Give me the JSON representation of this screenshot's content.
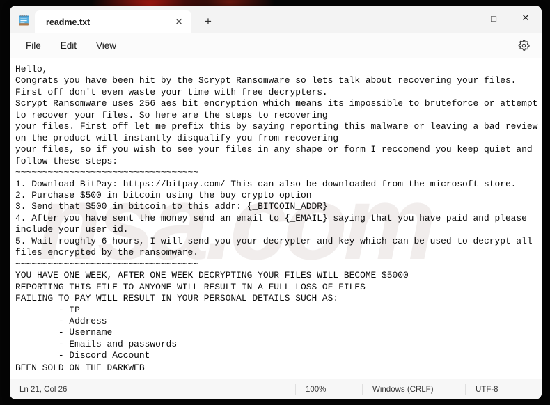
{
  "window": {
    "app_icon": "notepad-icon",
    "tab": {
      "title": "readme.txt",
      "close_label": "✕",
      "new_tab_label": "+"
    },
    "controls": {
      "minimize": "—",
      "maximize": "□",
      "close": "✕"
    }
  },
  "menu": {
    "items": [
      {
        "label": "File"
      },
      {
        "label": "Edit"
      },
      {
        "label": "View"
      }
    ],
    "settings_icon": "gear-icon"
  },
  "editor": {
    "content": "Hello,\nCongrats you have been hit by the Scrypt Ransomware so lets talk about recovering your files.\nFirst off don't even waste your time with free decrypters.\nScrypt Ransomware uses 256 aes bit encryption which means its impossible to bruteforce or attempt\nto recover your files. So here are the steps to recovering\nyour files. First off let me prefix this by saying reporting this malware or leaving a bad review\non the product will instantly disqualify you from recovering\nyour files, so if you wish to see your files in any shape or form I reccomend you keep quiet and\nfollow these steps:\n~~~~~~~~~~~~~~~~~~~~~~~~~~~~~~~~~~\n1. Download BitPay: https://bitpay.com/ This can also be downloaded from the microsoft store.\n2. Purchase $500 in bitcoin using the buy crypto option\n3. Send that $500 in bitcoin to this addr: {_BITCOIN_ADDR}\n4. After you have sent the money send an email to {_EMAIL} saying that you have paid and please\ninclude your user id.\n5. Wait roughly 6 hours, I will send you your decrypter and key which can be used to decrypt all\nfiles encrypted by the ransomware.\n~~~~~~~~~~~~~~~~~~~~~~~~~~~~~~~~~~\nYOU HAVE ONE WEEK, AFTER ONE WEEK DECRYPTING YOUR FILES WILL BECOME $5000\nREPORTING THIS FILE TO ANYONE WILL RESULT IN A FULL LOSS OF FILES\nFAILING TO PAY WILL RESULT IN YOUR PERSONAL DETAILS SUCH AS:\n        - IP\n        - Address\n        - Username\n        - Emails and passwords\n        - Discord Account\nBEEN SOLD ON THE DARKWEB",
    "watermark_text": "nsa.com"
  },
  "status_bar": {
    "position": "Ln 21, Col 26",
    "zoom": "100%",
    "line_ending": "Windows (CRLF)",
    "encoding": "UTF-8"
  },
  "colors": {
    "accent_blue": "#4aa3df",
    "window_bg": "#fbfbfb",
    "text": "#0a0a0a",
    "desktop": "#050505"
  }
}
